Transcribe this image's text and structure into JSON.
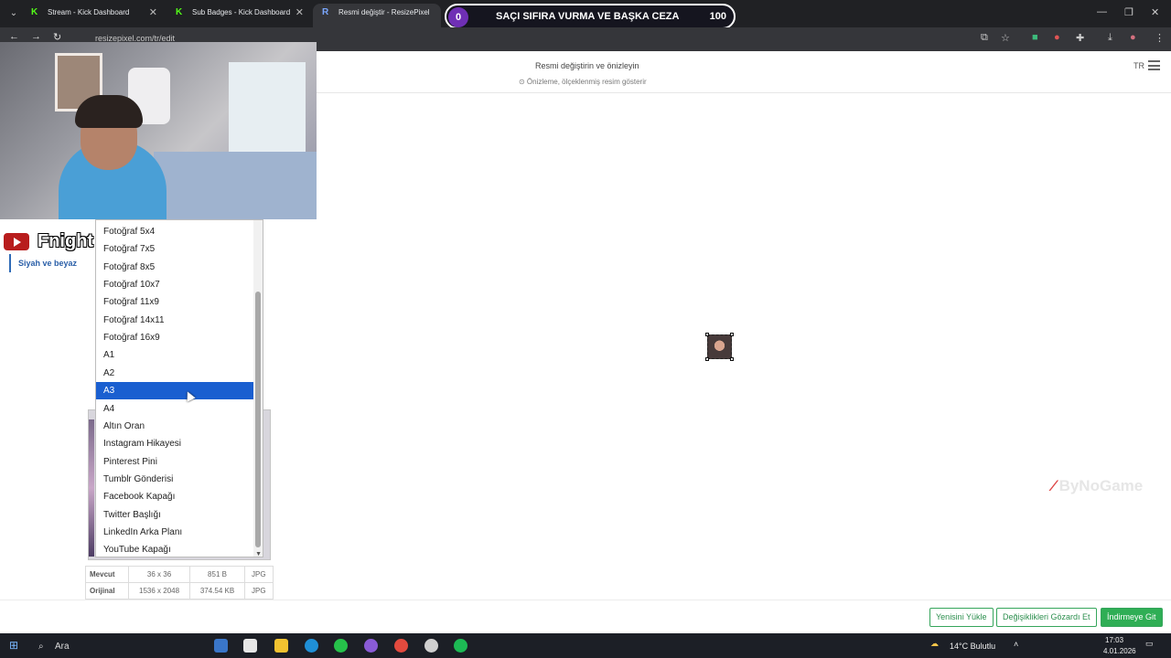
{
  "browser": {
    "tabs": [
      {
        "label": "Stream - Kick Dashboard",
        "favicon": "kick-icon"
      },
      {
        "label": "Sub Badges - Kick Dashboard",
        "favicon": "kick-icon"
      },
      {
        "label": "Resmi değiştir - ResizePixel",
        "favicon": "resizepixel-icon"
      }
    ],
    "url": "resizepixel.com/tr/edit"
  },
  "overlay": {
    "left_count": "0",
    "text": "SAÇI SIFIRA VURMA VE BAŞKA CEZA",
    "right_count": "100"
  },
  "webcam": {
    "channel_name": "Fnight"
  },
  "header": {
    "title": "Resmi değiştirin ve önizleyin",
    "subtitle": "⊙ Önizleme, ölçeklenmiş resim gösterir",
    "lang": "TR"
  },
  "sidebar": {
    "items": [
      {
        "label": "Siyah ve beyaz"
      }
    ]
  },
  "dropdown": {
    "options": [
      "Fotoğraf 5x4",
      "Fotoğraf 7x5",
      "Fotoğraf 8x5",
      "Fotoğraf 10x7",
      "Fotoğraf 11x9",
      "Fotoğraf 14x11",
      "Fotoğraf 16x9",
      "A1",
      "A2",
      "A3",
      "A4",
      "Altın Oran",
      "Instagram Hikayesi",
      "Pinterest Pini",
      "Tumblr Gönderisi",
      "Facebook Kapağı",
      "Twitter Başlığı",
      "LinkedIn Arka Planı",
      "YouTube Kapağı"
    ],
    "selected": "A3"
  },
  "info_table": {
    "rows": [
      {
        "label": "Mevcut",
        "dims": "36 x 36",
        "size": "851 B",
        "format": "JPG"
      },
      {
        "label": "Orijinal",
        "dims": "1536 x 2048",
        "size": "374.54 KB",
        "format": "JPG"
      }
    ]
  },
  "watermark": {
    "text": "ByNoGame"
  },
  "actions": {
    "upload_new": "Yenisini Yükle",
    "discard": "Değişiklikleri Gözardı Et",
    "go_download": "İndirmeye Git"
  },
  "taskbar": {
    "search_placeholder": "Ara",
    "weather": "14°C  Bulutlu",
    "time": "17:03",
    "date": "4.01.2026"
  },
  "colors": {
    "accent_green": "#2fae55",
    "selection_blue": "#1a5fd0",
    "sidebar_blue": "#2a5fa8"
  }
}
